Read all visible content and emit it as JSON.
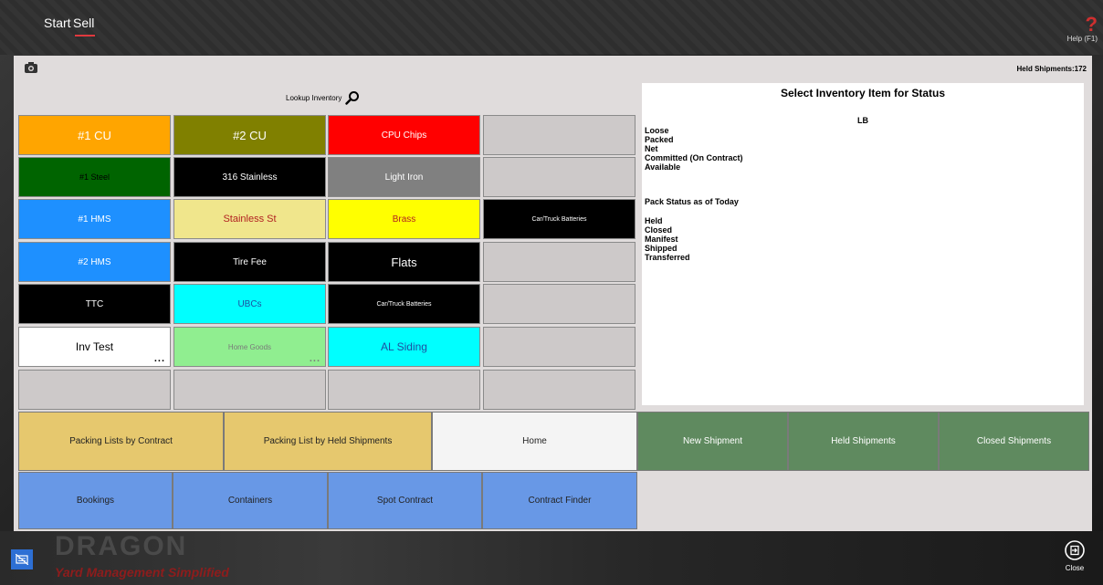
{
  "nav": {
    "tabs": [
      {
        "label": "Start"
      },
      {
        "label": "Sell"
      }
    ],
    "help_label": "Help (F1)"
  },
  "header": {
    "held_shipments": "Held Shipments:172",
    "lookup_label": "Lookup Inventory"
  },
  "tiles": [
    {
      "label": "#1 CU",
      "bg": "#ffa500",
      "fg": "#ffffff",
      "size": "13px"
    },
    {
      "label": "#2 CU",
      "bg": "#808000",
      "fg": "#ffffff",
      "size": "13px"
    },
    {
      "label": "CPU Chips",
      "bg": "#ff0000",
      "fg": "#ffffff",
      "size": "10px"
    },
    {
      "label": "",
      "bg": "#cdc9c9",
      "fg": "#000000",
      "size": "10px"
    },
    {
      "label": "#1 Steel",
      "bg": "#006400",
      "fg": "#000000",
      "size": "9px"
    },
    {
      "label": "316 Stainless",
      "bg": "#000000",
      "fg": "#ffffff",
      "size": "10px"
    },
    {
      "label": "Light Iron",
      "bg": "#808080",
      "fg": "#ffffff",
      "size": "10px"
    },
    {
      "label": "",
      "bg": "#cdc9c9",
      "fg": "#000000",
      "size": "10px"
    },
    {
      "label": "#1 HMS",
      "bg": "#1e90ff",
      "fg": "#ffffff",
      "size": "10px"
    },
    {
      "label": "Stainless St",
      "bg": "#f0e68c",
      "fg": "#b22222",
      "size": "11px"
    },
    {
      "label": "Brass",
      "bg": "#ffff00",
      "fg": "#b22222",
      "size": "10px"
    },
    {
      "label": "Car/Truck Batteries",
      "bg": "#000000",
      "fg": "#ffffff",
      "size": "7px"
    },
    {
      "label": "#2 HMS",
      "bg": "#1e90ff",
      "fg": "#ffffff",
      "size": "10px"
    },
    {
      "label": "Tire Fee",
      "bg": "#000000",
      "fg": "#ffffff",
      "size": "10px"
    },
    {
      "label": "Flats",
      "bg": "#000000",
      "fg": "#ffffff",
      "size": "13px"
    },
    {
      "label": "",
      "bg": "#cdc9c9",
      "fg": "#000000",
      "size": "10px"
    },
    {
      "label": "TTC",
      "bg": "#000000",
      "fg": "#ffffff",
      "size": "10px"
    },
    {
      "label": "UBCs",
      "bg": "#00ffff",
      "fg": "#1e4fa0",
      "size": "10px"
    },
    {
      "label": "Car/Truck Batteries",
      "bg": "#000000",
      "fg": "#ffffff",
      "size": "7px"
    },
    {
      "label": "",
      "bg": "#cdc9c9",
      "fg": "#000000",
      "size": "10px"
    },
    {
      "label": "Inv Test",
      "bg": "#ffffff",
      "fg": "#000000",
      "size": "12px",
      "more": "..."
    },
    {
      "label": "Home Goods",
      "bg": "#90ee90",
      "fg": "#7a7a7a",
      "size": "8px",
      "more": "..."
    },
    {
      "label": "AL Siding",
      "bg": "#00ffff",
      "fg": "#1e4fa0",
      "size": "12px"
    },
    {
      "label": "",
      "bg": "#cdc9c9",
      "fg": "#000000",
      "size": "10px"
    },
    {
      "label": "",
      "bg": "#cdc9c9",
      "fg": "#000000",
      "size": "10px"
    },
    {
      "label": "",
      "bg": "#cdc9c9",
      "fg": "#000000",
      "size": "10px"
    },
    {
      "label": "",
      "bg": "#cdc9c9",
      "fg": "#000000",
      "size": "10px"
    },
    {
      "label": "",
      "bg": "#cdc9c9",
      "fg": "#000000",
      "size": "10px"
    }
  ],
  "status": {
    "title": "Select Inventory Item for Status",
    "unit": "LB",
    "inventory_labels": [
      "Loose",
      "Packed",
      "Net",
      "Committed (On Contract)",
      "Available"
    ],
    "pack_heading": "Pack Status as of Today",
    "pack_labels": [
      "Held",
      "Closed",
      "Manifest",
      "Shipped",
      "Transferred"
    ]
  },
  "buttons": {
    "packing_by_contract": "Packing Lists by Contract",
    "packing_by_held": "Packing List by Held Shipments",
    "home": "Home",
    "new_shipment": "New Shipment",
    "held_shipments": "Held Shipments",
    "closed_shipments": "Closed Shipments",
    "bookings": "Bookings",
    "containers": "Containers",
    "spot_contract": "Spot Contract",
    "contract_finder": "Contract Finder"
  },
  "footer": {
    "brand": "DRAGON",
    "tagline": "Yard Management Simplified",
    "close_label": "Close"
  }
}
